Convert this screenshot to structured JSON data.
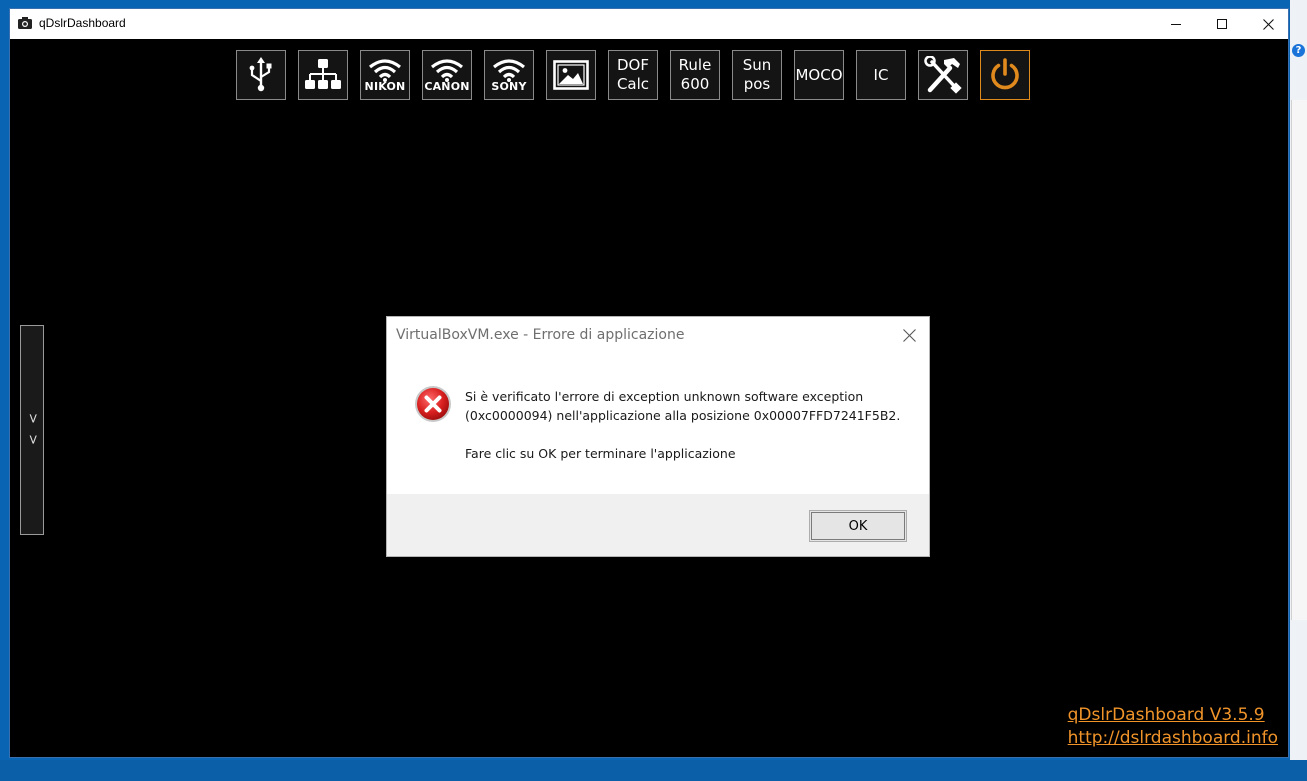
{
  "window": {
    "title": "qDslrDashboard",
    "app_icon": "camera-icon",
    "controls": [
      "minimize-icon",
      "maximize-icon",
      "close-icon"
    ]
  },
  "toolbar": {
    "buttons": [
      {
        "name": "usb",
        "icon": "usb-icon"
      },
      {
        "name": "network",
        "icon": "network-icon"
      },
      {
        "name": "nikon",
        "icon": "wifi-icon",
        "label": "NIKON"
      },
      {
        "name": "canon",
        "icon": "wifi-icon",
        "label": "CANON"
      },
      {
        "name": "sony",
        "icon": "wifi-icon",
        "label": "SONY"
      },
      {
        "name": "gallery",
        "icon": "image-icon"
      },
      {
        "name": "dof-calc",
        "line1": "DOF",
        "line2": "Calc"
      },
      {
        "name": "rule-600",
        "line1": "Rule",
        "line2": "600"
      },
      {
        "name": "sun-pos",
        "line1": "Sun",
        "line2": "pos"
      },
      {
        "name": "moco",
        "line1": "MOCO"
      },
      {
        "name": "ic",
        "line1": "IC"
      },
      {
        "name": "tools",
        "icon": "tools-icon"
      },
      {
        "name": "power",
        "icon": "power-icon",
        "accent": "#e08a1e"
      }
    ]
  },
  "side_handle": {
    "label": "> >"
  },
  "footer": {
    "version": "qDslrDashboard V3.5.9",
    "url": "http://dslrdashboard.info",
    "color": "#f0942a"
  },
  "dialog": {
    "title": "VirtualBoxVM.exe - Errore di applicazione",
    "icon": "error-icon",
    "message_line1": "Si è verificato l'errore di exception unknown software exception",
    "message_line2": "(0xc0000094) nell'applicazione alla posizione  0x00007FFD7241F5B2.",
    "message_line3": "Fare clic su OK per terminare l'applicazione",
    "ok_label": "OK"
  },
  "desktop": {
    "help_label": "?"
  }
}
